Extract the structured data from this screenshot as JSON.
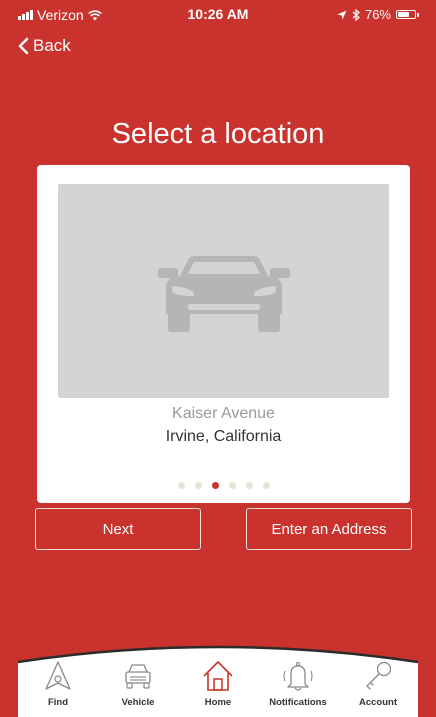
{
  "status_bar": {
    "carrier": "Verizon",
    "time": "10:26 AM",
    "battery": "76%",
    "battery_level": 0.76
  },
  "nav": {
    "back_label": "Back"
  },
  "title": "Select a location",
  "location": {
    "street": "Kaiser Avenue",
    "city": "Irvine, California",
    "image_icon": "car-icon"
  },
  "pager": {
    "count": 6,
    "active_index": 2
  },
  "buttons": {
    "next_label": "Next",
    "address_label": "Enter an Address"
  },
  "tabs": [
    {
      "label": "Find",
      "icon": "navigation-arrow-icon"
    },
    {
      "label": "Vehicle",
      "icon": "car-front-icon"
    },
    {
      "label": "Home",
      "icon": "home-icon"
    },
    {
      "label": "Notifications",
      "icon": "bell-icon"
    },
    {
      "label": "Account",
      "icon": "key-icon"
    }
  ],
  "colors": {
    "brand": "#c9322d",
    "active_tab": "#c9322d",
    "inactive_tab": "#888888"
  }
}
